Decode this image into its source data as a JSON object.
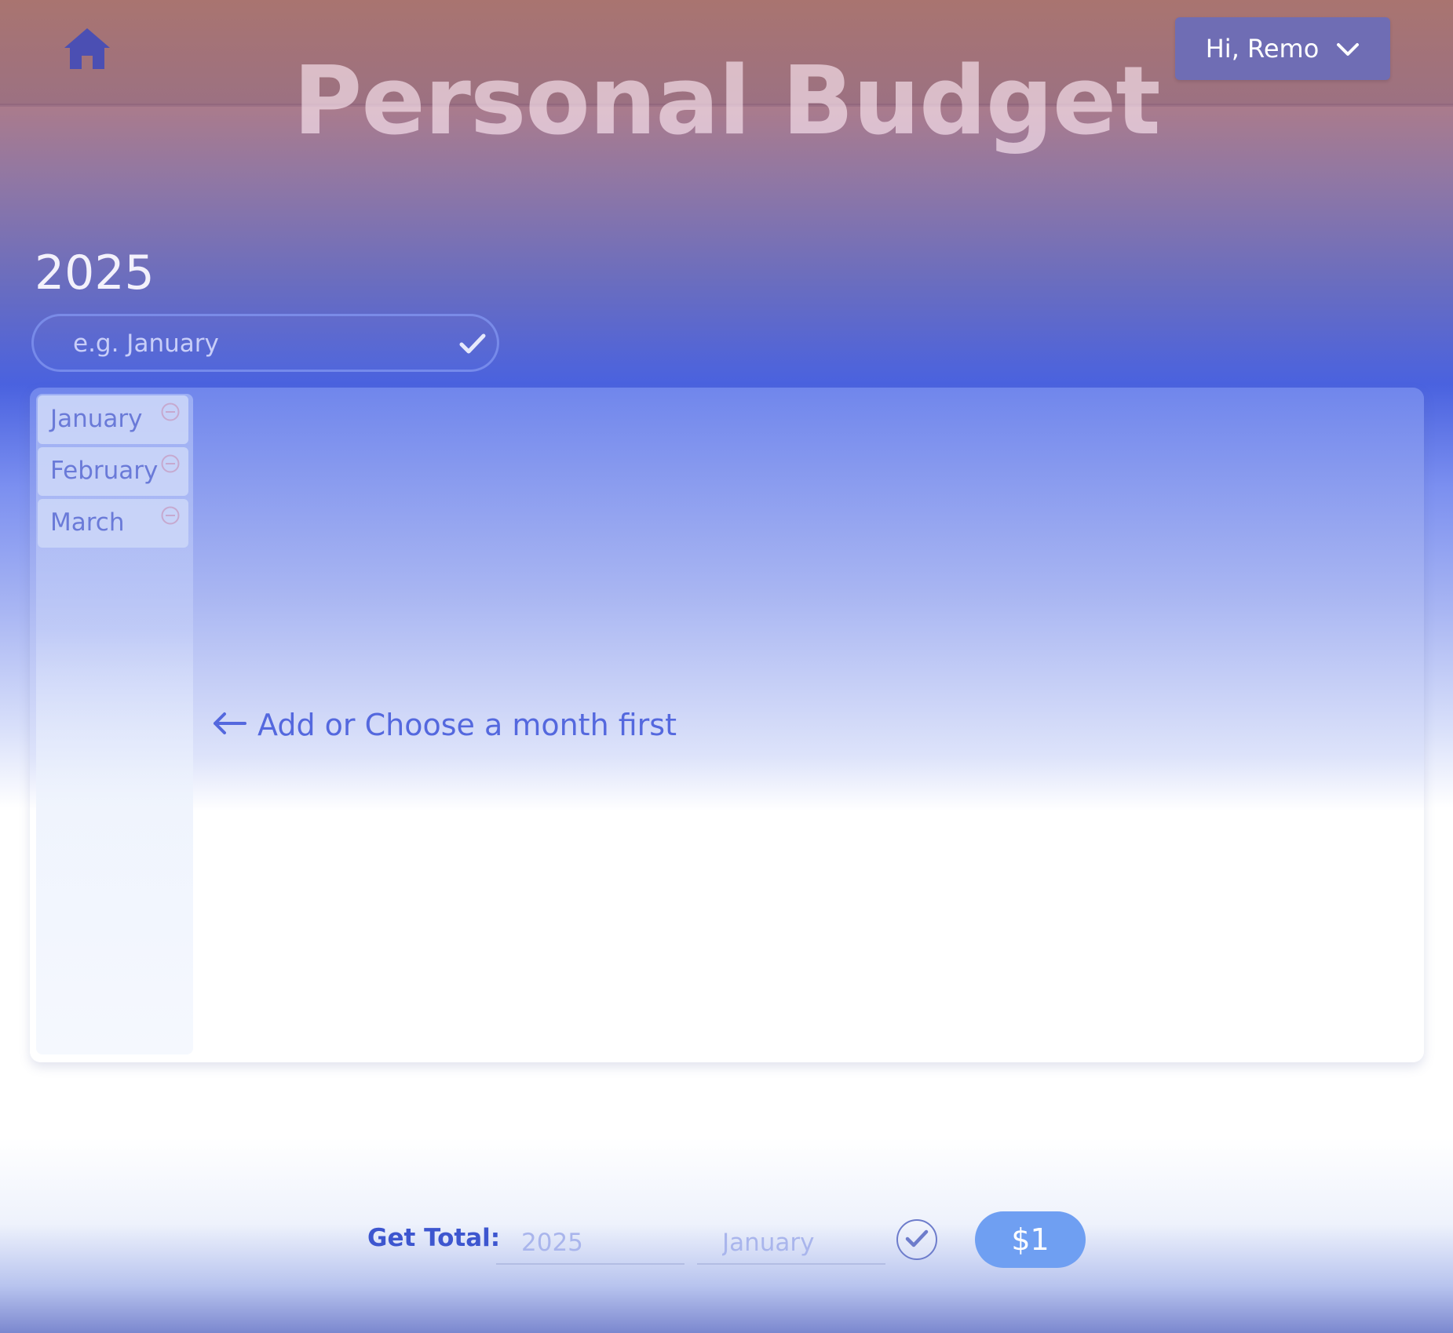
{
  "header": {
    "home_icon": "home-icon",
    "title": "Personal Budget",
    "user_menu_label": "Hi, Remo",
    "user_menu_icon": "chevron-down-icon"
  },
  "year_section": {
    "year": "2025",
    "month_input_placeholder": "e.g. January",
    "month_input_value": "",
    "add_icon": "check-icon"
  },
  "months": {
    "items": [
      {
        "label": "January",
        "remove_icon": "minus-circle-icon"
      },
      {
        "label": "February",
        "remove_icon": "minus-circle-icon"
      },
      {
        "label": "March",
        "remove_icon": "minus-circle-icon"
      }
    ],
    "empty_hint": "Add or Choose a month first",
    "hint_icon": "arrow-left-icon"
  },
  "total": {
    "label": "Get Total:",
    "year_placeholder": "2025",
    "month_placeholder": "January",
    "submit_icon": "check-circle-icon",
    "amount": "$1"
  },
  "colors": {
    "accent": "#4a62df",
    "user_button": "#6f6db4",
    "amount_badge": "#6f9ff2",
    "text_blue": "#3d56cf"
  }
}
